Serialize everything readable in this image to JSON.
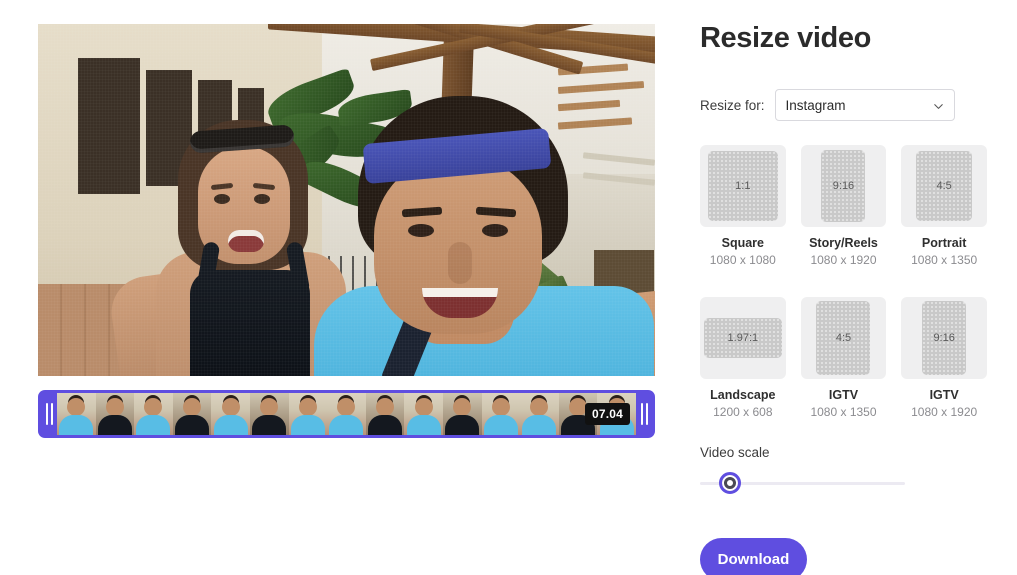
{
  "panel": {
    "title": "Resize video",
    "resize_for_label": "Resize for:",
    "platform_selected": "Instagram",
    "platform_options": [
      "Instagram"
    ],
    "chevron_icon": "chevron-down-icon",
    "presets": [
      {
        "ratio": "1:1",
        "name": "Square",
        "dimensions": "1080 x 1080"
      },
      {
        "ratio": "9:16",
        "name": "Story/Reels",
        "dimensions": "1080 x 1920"
      },
      {
        "ratio": "4:5",
        "name": "Portrait",
        "dimensions": "1080 x 1350"
      },
      {
        "ratio": "1.97:1",
        "name": "Landscape",
        "dimensions": "1200 x 608"
      },
      {
        "ratio": "4:5",
        "name": "IGTV",
        "dimensions": "1080 x 1350"
      },
      {
        "ratio": "9:16",
        "name": "IGTV",
        "dimensions": "1080 x 1920"
      }
    ],
    "video_scale_label": "Video scale",
    "video_scale_value": "15",
    "download_label": "Download"
  },
  "editor": {
    "timeline": {
      "duration_badge": "07.04",
      "left_handle_icon": "trim-handle-left-icon",
      "right_handle_icon": "trim-handle-right-icon"
    }
  },
  "colors": {
    "accent": "#5f4ee0",
    "panel_background": "#ffffff",
    "preset_card": "#efeff0",
    "ratio_box": "#c9c9c9",
    "text_primary": "#2b2b2b",
    "text_muted": "#8b8b8f",
    "badge_background": "#111111"
  }
}
